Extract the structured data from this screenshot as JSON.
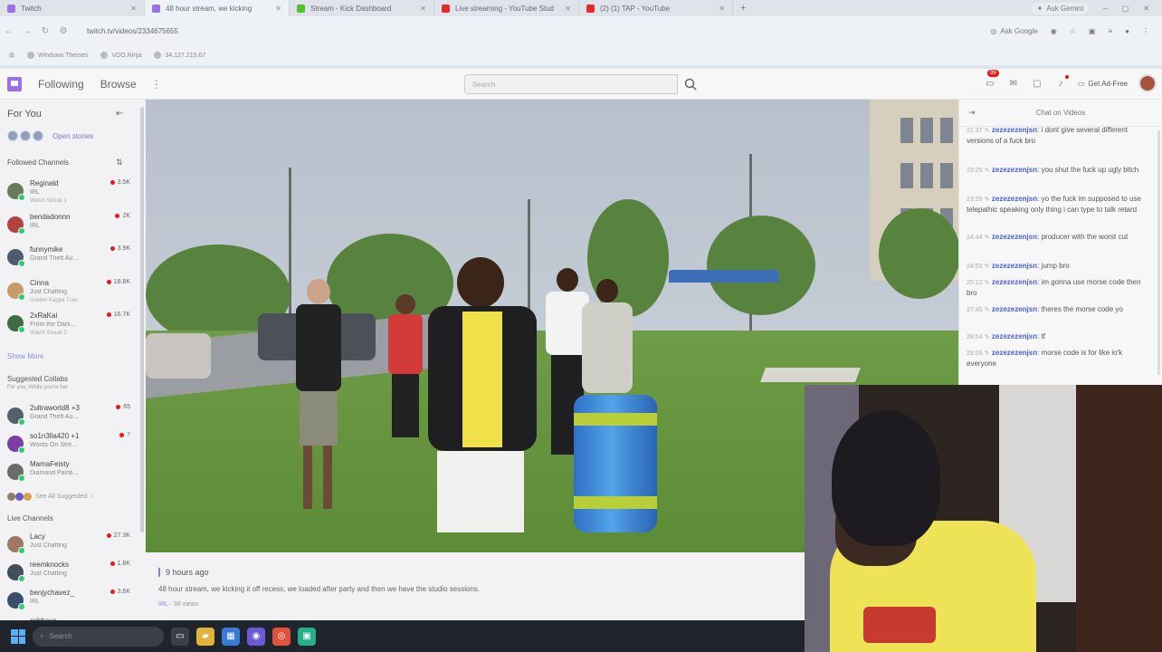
{
  "browser": {
    "tabs": [
      {
        "title": "Twitch",
        "icon_color": "#9a70e8",
        "active": false
      },
      {
        "title": "48 hour stream, we kicking",
        "icon_color": "#9a70e8",
        "active": true
      },
      {
        "title": "Stream - Kick Dashboard",
        "icon_color": "#53c02f",
        "active": false
      },
      {
        "title": "Live streaming - YouTube Stud",
        "icon_color": "#e62b2b",
        "active": false
      },
      {
        "title": "(2) (1) TAP - YouTube",
        "icon_color": "#e62b2b",
        "active": false
      }
    ],
    "new_tab": "+",
    "ask_gemini": "Ask Gemini",
    "url": "twitch.tv/videos/2334675655",
    "ask_google": "Ask Google",
    "bookmarks": [
      "Windows Themes",
      "VDO.Ninja",
      "34.127.215.67"
    ]
  },
  "header": {
    "following": "Following",
    "browse": "Browse",
    "more": "⋮",
    "search_placeholder": "Search",
    "notifications_count": "99",
    "get_ad_free": "Get Ad-Free"
  },
  "sidebar": {
    "for_you": "For You",
    "open_stories": "Open stories",
    "followed_heading": "Followed Channels",
    "followed": [
      {
        "name": "Reginald",
        "game": "IRL",
        "extra": "Watch Streak 1",
        "viewers": "3.5K",
        "color": "#6b7a5a"
      },
      {
        "name": "bendadonnn",
        "game": "IRL",
        "extra": "",
        "viewers": "2K",
        "color": "#b0413e"
      },
      {
        "name": "funnymike",
        "game": "Grand Theft Au...",
        "extra": "",
        "viewers": "3.9K",
        "color": "#4d5b6e"
      },
      {
        "name": "Cinna",
        "game": "Just Chatting",
        "extra": "Golden Kappa Train",
        "viewers": "18.8K",
        "color": "#c79a6a"
      },
      {
        "name": "2xRaKai",
        "game": "From the Dark...",
        "extra": "Watch Streak 2",
        "viewers": "16.7K",
        "color": "#3f6b45"
      }
    ],
    "show_more": "Show More",
    "suggested_heading": "Suggested Collabs",
    "suggested_sub": "For you, While you're her",
    "suggested": [
      {
        "name": "2ultraworld8 +3",
        "game": "Grand Theft Au...",
        "viewers": "65",
        "color": "#55606d"
      },
      {
        "name": "so1n3lla420 +1",
        "game": "Words On Stre...",
        "viewers": "7",
        "color": "#7a3fa0"
      },
      {
        "name": "MamaFeisty",
        "game": "Diamond Painti...",
        "viewers": "",
        "color": "#6c6c6c"
      }
    ],
    "see_all": "See All Suggested",
    "live_heading": "Live Channels",
    "live": [
      {
        "name": "Lacy",
        "game": "Just Chatting",
        "viewers": "27.3K",
        "color": "#a07860"
      },
      {
        "name": "reemknocks",
        "game": "Just Chatting",
        "viewers": "1.8K",
        "color": "#3f4f5c"
      },
      {
        "name": "benjychavez_",
        "game": "IRL",
        "viewers": "3.6K",
        "color": "#3c4e6e"
      },
      {
        "name": "cchhaus",
        "game": "",
        "viewers": "",
        "color": "#5a5a5a"
      }
    ]
  },
  "video": {
    "time_ago": "9 hours ago",
    "title": "48 hour stream, we kicking it off recess, we loaded after party and then we have the studio sessions.",
    "category": "IRL",
    "views": "38 views"
  },
  "chat": {
    "header": "Chat on Videos",
    "messages": [
      {
        "time": "21:37",
        "user": "zezezezenjsn",
        "text": "i dont give several different versions of a fuck bro"
      },
      {
        "time": "22:25",
        "user": "zezezezenjsn",
        "text": "you shut the fuck up ugly bitch"
      },
      {
        "time": "23:55",
        "user": "zezezezenjsn",
        "text": "yo the fuck im supposed to use telepathic speaking only thing i can type to talk retard"
      },
      {
        "time": "24:44",
        "user": "zezezezenjsn",
        "text": "producer with the worst cut"
      },
      {
        "time": "24:53",
        "user": "zezezezenjsn",
        "text": "jump bro"
      },
      {
        "time": "25:12",
        "user": "zezezezenjsn",
        "text": "im gonna use morse code then bro"
      },
      {
        "time": "27:45",
        "user": "zezezezenjsn",
        "text": "theres the morse code yo"
      },
      {
        "time": "28:54",
        "user": "zezezezenjsn",
        "text": "tf"
      },
      {
        "time": "29:05",
        "user": "zezezezenjsn",
        "text": "morse code is for like io'k everyone"
      }
    ]
  },
  "taskbar": {
    "search_placeholder": "Search",
    "apps": [
      {
        "icon": "task-view-icon",
        "color": "#3a3f4a"
      },
      {
        "icon": "folder-icon",
        "color": "#e0b33a"
      },
      {
        "icon": "store-icon",
        "color": "#3a7bd5"
      },
      {
        "icon": "obs-icon",
        "color": "#6b5ad8"
      },
      {
        "icon": "chrome-icon",
        "color": "#e0533a"
      },
      {
        "icon": "app-icon",
        "color": "#23b08a"
      }
    ]
  }
}
